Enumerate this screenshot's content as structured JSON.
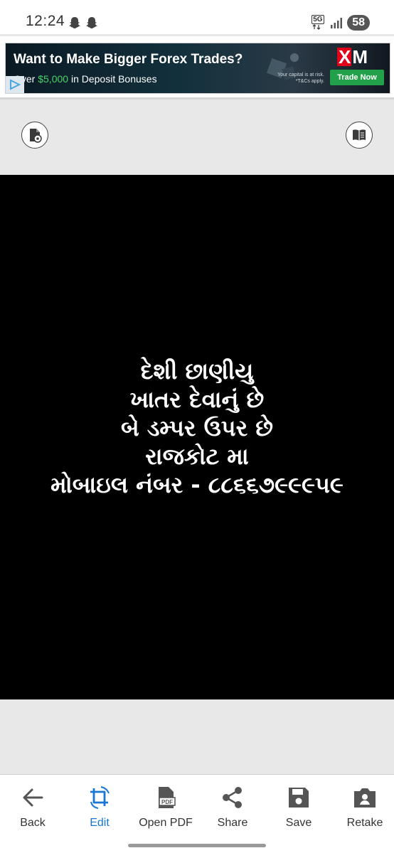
{
  "status_bar": {
    "time": "12:24",
    "network": "5G",
    "battery": "58"
  },
  "ad": {
    "headline": "Want to Make Bigger Forex Trades?",
    "sub_prefix": "Over ",
    "sub_highlight": "$5,000",
    "sub_suffix": " in Deposit Bonuses",
    "brand": "XM",
    "disclaimer_line1": "Your capital is at risk.",
    "disclaimer_line2": "*T&Cs apply.",
    "cta": "Trade Now",
    "accent": "#22a14a"
  },
  "viewer": {
    "left_button_icon": "file-lock-icon",
    "right_button_icon": "book-icon",
    "page_background": "#000000",
    "lines": [
      "દેશી છાણીયુ",
      "ખાતર દેવાનું છે",
      "બે ડમ્પર ઉપર છે",
      "રાજકોટ મા",
      "મોબાઇલ નંબર - ૮૮૬૬૭૯૯૯૫૯"
    ]
  },
  "toolbar": {
    "items": [
      {
        "label": "Back",
        "icon": "arrow-left-icon"
      },
      {
        "label": "Edit",
        "icon": "crop-rotate-icon"
      },
      {
        "label": "Open PDF",
        "icon": "pdf-icon"
      },
      {
        "label": "Share",
        "icon": "share-icon"
      },
      {
        "label": "Save",
        "icon": "save-icon"
      },
      {
        "label": "Retake",
        "icon": "camera-retake-icon"
      }
    ],
    "active_color": "#1976d2"
  }
}
